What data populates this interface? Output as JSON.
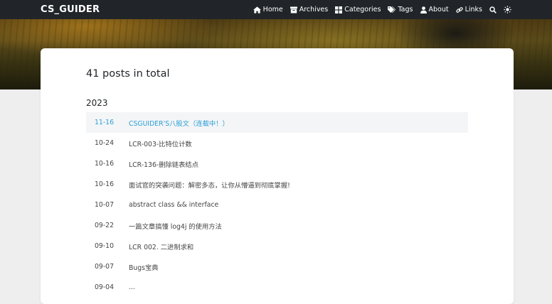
{
  "navbar": {
    "brand": "CS_GUIDER",
    "items": [
      {
        "label": "Home",
        "icon": "home-icon"
      },
      {
        "label": "Archives",
        "icon": "archive-icon"
      },
      {
        "label": "Categories",
        "icon": "th-large-icon"
      },
      {
        "label": "Tags",
        "icon": "tags-icon"
      },
      {
        "label": "About",
        "icon": "user-icon"
      },
      {
        "label": "Links",
        "icon": "link-icon"
      }
    ],
    "search_icon": "search-icon",
    "theme_icon": "sun-icon"
  },
  "archive": {
    "total": "41 posts in total",
    "year": "2023",
    "posts": [
      {
        "date": "11-16",
        "title": "CSGUIDER'S八股文（连载中！）"
      },
      {
        "date": "10-24",
        "title": "LCR-003-比特位计数"
      },
      {
        "date": "10-16",
        "title": "LCR-136-删除链表结点"
      },
      {
        "date": "10-16",
        "title": "面试官的突袭问题：解密多态，让你从懵逼到彻底掌握!"
      },
      {
        "date": "10-07",
        "title": "abstract class && interface"
      },
      {
        "date": "09-22",
        "title": "一篇文章搞懂 log4j 的使用方法"
      },
      {
        "date": "09-10",
        "title": "LCR 002. 二进制求和"
      },
      {
        "date": "09-07",
        "title": "Bugs宝典"
      },
      {
        "date": "09-04",
        "title": "..."
      }
    ]
  },
  "colors": {
    "navbar_bg": "#212529",
    "link_active": "#2a9fd6",
    "page_bg": "#eeeeee"
  }
}
